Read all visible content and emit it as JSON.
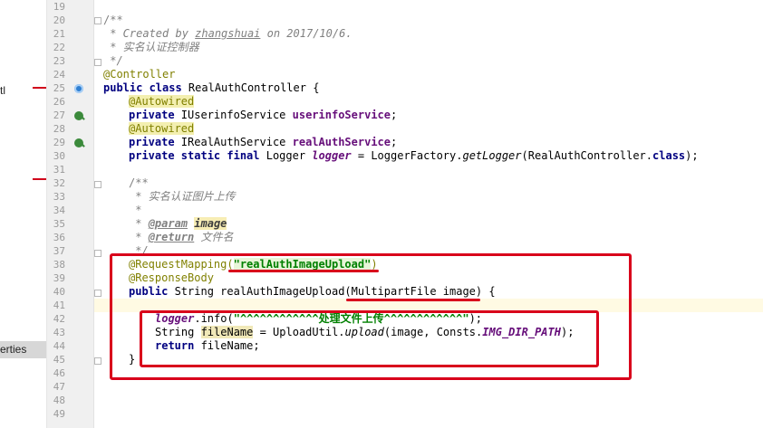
{
  "side_panel": {
    "truncated_label_top": "tl",
    "truncated_label_properties": "erties"
  },
  "line_numbers": [
    "19",
    "20",
    "21",
    "22",
    "23",
    "24",
    "25",
    "26",
    "27",
    "28",
    "29",
    "30",
    "31",
    "32",
    "33",
    "34",
    "35",
    "36",
    "37",
    "38",
    "39",
    "40",
    "41",
    "42",
    "43",
    "44",
    "45",
    "46",
    "47",
    "48",
    "49"
  ],
  "code": {
    "l20": "/**",
    "l21_prefix": " * Created by ",
    "l21_author": "zhangshuai",
    "l21_suffix": " on 2017/10/6.",
    "l22": " * 实名认证控制器",
    "l23": " */",
    "l24": "@Controller",
    "l25_kw": "public class ",
    "l25_rest": "RealAuthController {",
    "l26": "@Autowired",
    "l27_kw": "private ",
    "l27_type": "IUserinfoService ",
    "l27_field": "userinfoService",
    "l27_end": ";",
    "l28": "@Autowired",
    "l29_kw": "private ",
    "l29_type": "IRealAuthService ",
    "l29_field": "realAuthService",
    "l29_end": ";",
    "l30_kw": "private static final ",
    "l30_type": "Logger ",
    "l30_field": "logger",
    "l30_mid": " = LoggerFactory.",
    "l30_method": "getLogger",
    "l30_arg": "(RealAuthController.",
    "l30_class_kw": "class",
    "l30_end": ");",
    "l32": "/**",
    "l33": " * 实名认证图片上传",
    "l34": " *",
    "l35_star": " * ",
    "l35_tag": "@param",
    "l35_name": "image",
    "l36_star": " * ",
    "l36_tag": "@return",
    "l36_text": " 文件名",
    "l37": " */",
    "l38_ann": "@RequestMapping(",
    "l38_str": "\"realAuthImageUpload\"",
    "l38_end": ")",
    "l39": "@ResponseBody",
    "l40_kw": "public ",
    "l40_rest": "String realAuthImageUpload(MultipartFile image) {",
    "l42_field": "logger",
    "l42_mid": ".info(",
    "l42_str": "\"^^^^^^^^^^^^处理文件上传^^^^^^^^^^^^\"",
    "l42_end": ");",
    "l43_type": "String ",
    "l43_var": "fileName",
    "l43_mid": " = UploadUtil.",
    "l43_method": "upload",
    "l43_arg": "(image, Consts.",
    "l43_const": "IMG_DIR_PATH",
    "l43_end": ");",
    "l44_kw": "return ",
    "l44_rest": "fileName;",
    "l45": "}"
  },
  "colors": {
    "annotation_red": "#d9001b",
    "keyword": "#000080",
    "field": "#660e7a",
    "string": "#008000",
    "annotation": "#808000",
    "comment": "#808080"
  }
}
